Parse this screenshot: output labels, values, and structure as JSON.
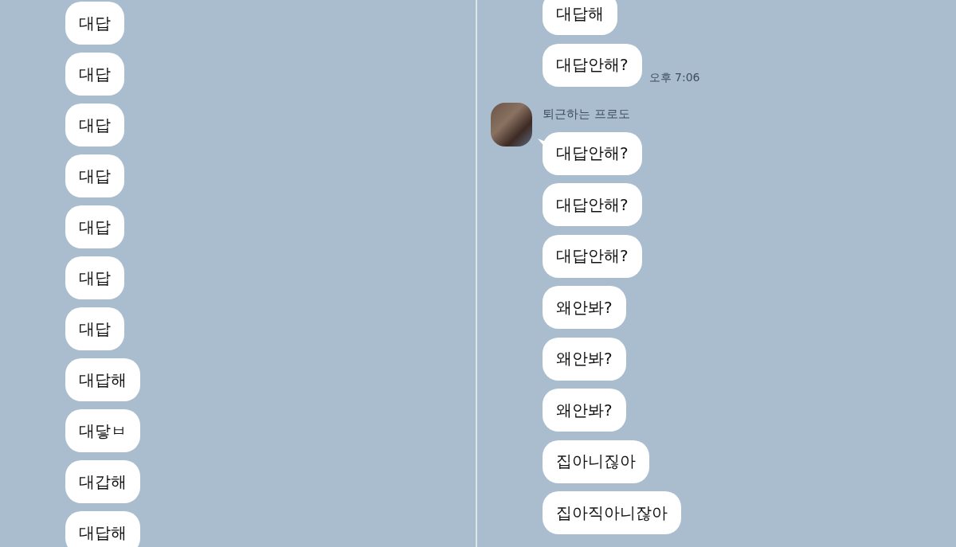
{
  "panels": [
    {
      "items": [
        {
          "kind": "bubble",
          "text": "대답"
        },
        {
          "kind": "bubble",
          "text": "대답"
        },
        {
          "kind": "bubble",
          "text": "대답"
        },
        {
          "kind": "bubble",
          "text": "대답"
        },
        {
          "kind": "bubble",
          "text": "대답"
        },
        {
          "kind": "bubble",
          "text": "대답"
        },
        {
          "kind": "bubble",
          "text": "대답"
        },
        {
          "kind": "bubble",
          "text": "대답해"
        },
        {
          "kind": "bubble",
          "text": "대닿ㅂ"
        },
        {
          "kind": "bubble",
          "text": "대갑해"
        },
        {
          "kind": "bubble",
          "text": "대답해"
        }
      ]
    },
    {
      "items": [
        {
          "kind": "bubble",
          "text": "대답해"
        },
        {
          "kind": "bubble",
          "text": "대답안해?",
          "time": "오후 7:06"
        },
        {
          "kind": "sender",
          "name": "퇴근하는 프로도"
        },
        {
          "kind": "bubble",
          "text": "대답안해?",
          "tail": true
        },
        {
          "kind": "bubble",
          "text": "대답안해?"
        },
        {
          "kind": "bubble",
          "text": "대답안해?"
        },
        {
          "kind": "bubble",
          "text": "왜안봐?"
        },
        {
          "kind": "bubble",
          "text": "왜안봐?"
        },
        {
          "kind": "bubble",
          "text": "왜안봐?"
        },
        {
          "kind": "bubble",
          "text": "집아니짆아"
        },
        {
          "kind": "bubble",
          "text": "집아직아니잖아"
        }
      ]
    }
  ]
}
